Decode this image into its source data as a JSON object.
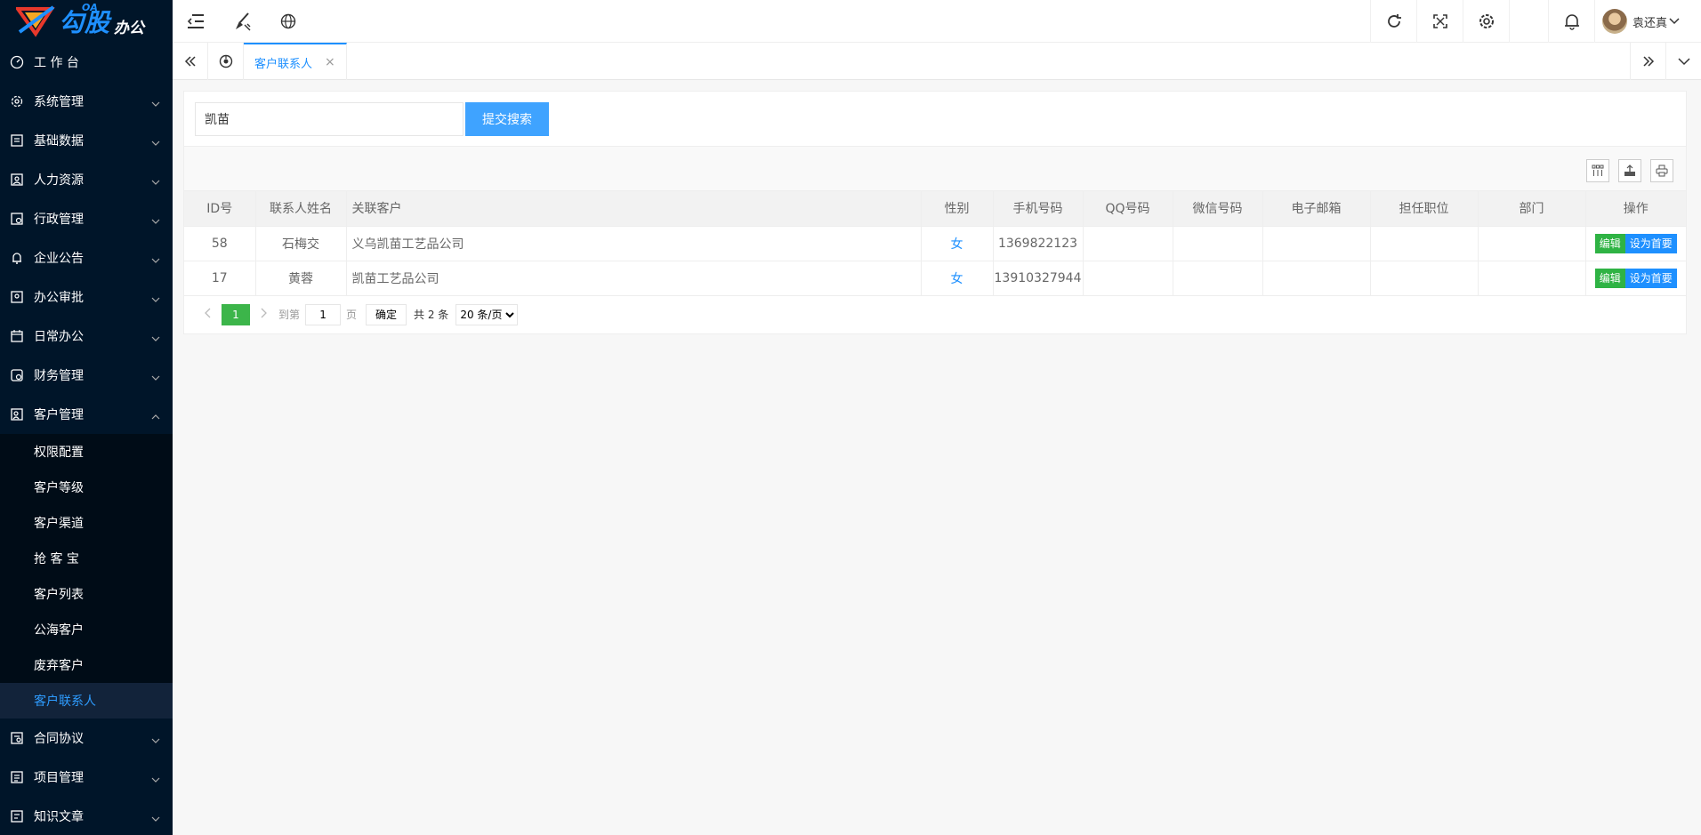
{
  "logo": {
    "oa": "OA",
    "main": "勾股",
    "sub": "办公"
  },
  "sidebar": {
    "items": [
      {
        "label": "工 作 台",
        "icon": "dashboard-icon",
        "arrow": false
      },
      {
        "label": "系统管理",
        "icon": "gear-icon",
        "arrow": true
      },
      {
        "label": "基础数据",
        "icon": "database-icon",
        "arrow": true
      },
      {
        "label": "人力资源",
        "icon": "person-icon",
        "arrow": true
      },
      {
        "label": "行政管理",
        "icon": "admin-icon",
        "arrow": true
      },
      {
        "label": "企业公告",
        "icon": "bell-icon",
        "arrow": true
      },
      {
        "label": "办公审批",
        "icon": "approval-icon",
        "arrow": true
      },
      {
        "label": "日常办公",
        "icon": "calendar-icon",
        "arrow": true
      },
      {
        "label": "财务管理",
        "icon": "finance-icon",
        "arrow": true
      },
      {
        "label": "客户管理",
        "icon": "customer-icon",
        "arrow": true,
        "expanded": true
      }
    ],
    "customer_sub": [
      {
        "label": "权限配置"
      },
      {
        "label": "客户等级"
      },
      {
        "label": "客户渠道"
      },
      {
        "label": "抢 客 宝"
      },
      {
        "label": "客户列表"
      },
      {
        "label": "公海客户"
      },
      {
        "label": "废弃客户"
      },
      {
        "label": "客户联系人",
        "active": true
      }
    ],
    "items_after": [
      {
        "label": "合同协议",
        "icon": "contract-icon"
      },
      {
        "label": "项目管理",
        "icon": "project-icon"
      },
      {
        "label": "知识文章",
        "icon": "article-icon"
      }
    ]
  },
  "header": {
    "left_icons": [
      "menu-fold-icon",
      "brush-icon",
      "globe-icon"
    ],
    "right_icons": [
      "refresh-icon",
      "fullscreen-icon",
      "settings-icon"
    ],
    "notify_icon": "bell-icon",
    "user_name": "袁还真"
  },
  "tabs": {
    "active_label": "客户联系人",
    "close": "×"
  },
  "search": {
    "value": "凯苗",
    "button": "提交搜索"
  },
  "table": {
    "columns": [
      "ID号",
      "联系人姓名",
      "关联客户",
      "性别",
      "手机号码",
      "QQ号码",
      "微信号码",
      "电子邮箱",
      "担任职位",
      "部门",
      "操作"
    ],
    "rows": [
      {
        "id": "58",
        "name": "石梅交",
        "customer": "义乌凯苗工艺品公司",
        "gender": "女",
        "phone": "1369822123",
        "qq": "",
        "wechat": "",
        "email": "",
        "position": "",
        "dept": ""
      },
      {
        "id": "17",
        "name": "黄蓉",
        "customer": "凯苗工艺品公司",
        "gender": "女",
        "phone": "13910327944",
        "qq": "",
        "wechat": "",
        "email": "",
        "position": "",
        "dept": ""
      }
    ],
    "op_edit": "编辑",
    "op_primary": "设为首要"
  },
  "pager": {
    "current": "1",
    "goto_label": "到第",
    "goto_value": "1",
    "page_label": "页",
    "confirm": "确定",
    "total": "共 2 条",
    "page_size": "20 条/页"
  },
  "colors": {
    "sidebar_bg": "#001529",
    "accent": "#1e90ff",
    "edit_green": "#2fb344",
    "pager_green": "#3cb54a"
  }
}
